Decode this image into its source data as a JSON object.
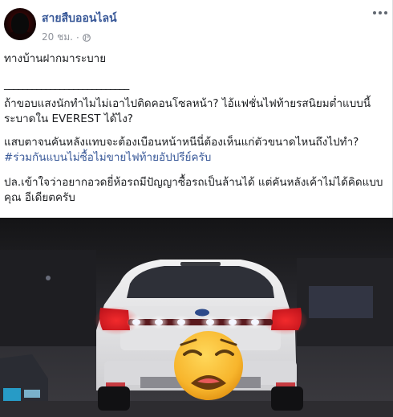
{
  "post": {
    "page_name": "สายสืบออนไลน์",
    "timestamp": "20 ชม.",
    "separator": "·",
    "privacy_icon": "globe-icon",
    "more_icon": "more-options-icon",
    "paragraphs": {
      "p1": "ทางบ้านฝากมาระบาย",
      "p2": "___________________________",
      "p3": "ถ้าขอบแสงนักทำไมไม่เอาไปติดคอนโซลหน้า? ไอ้แฟชั่นไฟท้ายรสนิยมต่ำแบบนี้ระบาดใน EVEREST ได้ไง?",
      "p4_text": "แสบตาจนคันหลังแทบจะต้องเบือนหน้าหนีนี่ต้องเห็นแก่ตัวขนาดไหนถึงไปทำ? ",
      "p4_hashtag": "#ร่วมกันแบนไม่ซื้อไม่ขายไฟท้ายอัปปรีย์ครับ",
      "p5": "ปล.เข้าใจว่าอยากอวดยี่ห้อรถมีปัญญาซื้อรถเป็นล้านได้ แต่คันหลังเค้าไม่ได้คิดแบบคุณ อีเดียตครับ"
    }
  },
  "photo": {
    "subject": "white SUV rear at night with LED light bar",
    "emoji_icon": "weary-face-emoji-icon",
    "colors": {
      "car_body": "#e9e9ea",
      "tail_light": "#e0202a",
      "led": "#f4f6ff",
      "night_sky": "#1a1a1c"
    }
  }
}
